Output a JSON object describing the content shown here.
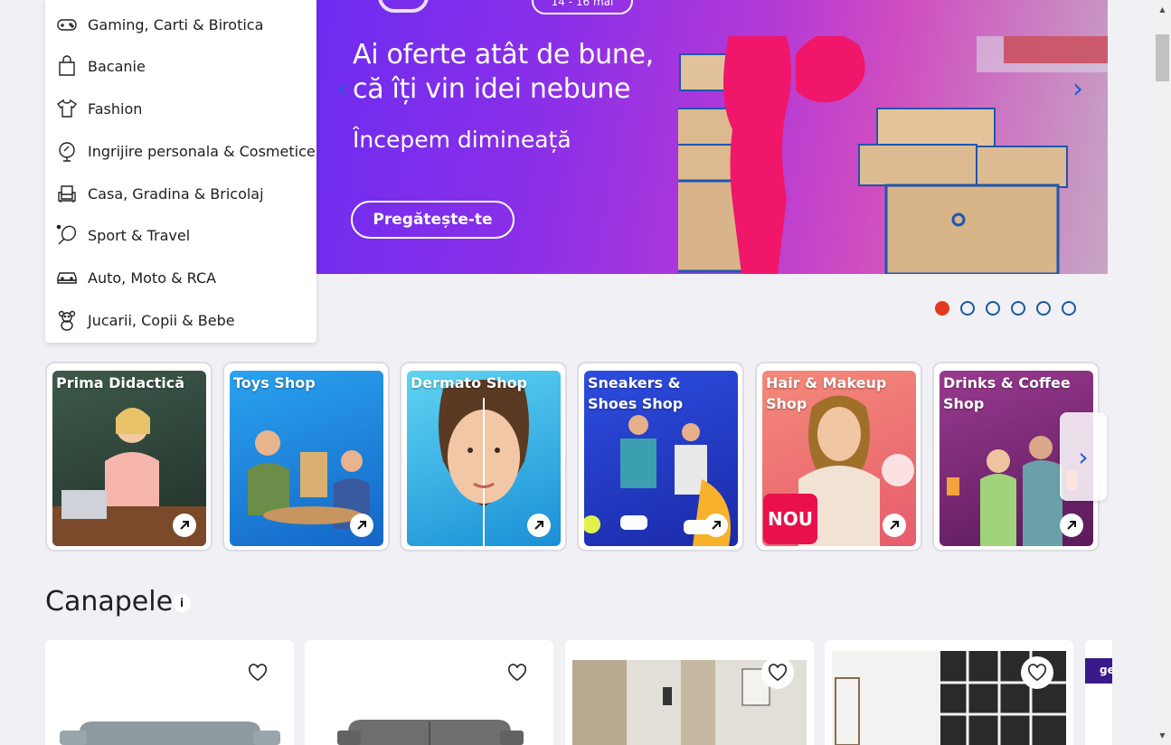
{
  "category_menu": {
    "items": [
      {
        "label": "Gaming, Carti & Birotica",
        "icon": "gamepad-icon"
      },
      {
        "label": "Bacanie",
        "icon": "shopping-bag-icon"
      },
      {
        "label": "Fashion",
        "icon": "tshirt-icon"
      },
      {
        "label": "Ingrijire personala & Cosmetice",
        "icon": "cosmetics-icon"
      },
      {
        "label": "Casa, Gradina & Bricolaj",
        "icon": "armchair-icon"
      },
      {
        "label": "Sport & Travel",
        "icon": "racket-icon"
      },
      {
        "label": "Auto, Moto & RCA",
        "icon": "car-icon"
      },
      {
        "label": "Jucarii, Copii & Bebe",
        "icon": "teddy-bear-icon"
      }
    ]
  },
  "hero": {
    "date_label": "14 - 16 mai",
    "headline_line1": "Ai oferte atât de bune,",
    "headline_line2": "că îți vin idei nebune",
    "subtitle": "Începem dimineață",
    "cta": "Pregătește-te",
    "active_slide": 1,
    "slide_count": 6
  },
  "shops": {
    "items": [
      {
        "title": "Prima Didactică",
        "bg": "#2f4a3c"
      },
      {
        "title": "Toys Shop",
        "bg": "#1e88d8"
      },
      {
        "title": "Dermato Shop",
        "bg": "#2fb6e6"
      },
      {
        "title": "Sneakers & Shoes Shop",
        "bg": "#2b3ed0"
      },
      {
        "title": "Hair & Makeup Shop",
        "bg": "#f1706a",
        "badge": "NOU"
      },
      {
        "title": "Drinks & Coffee Shop",
        "bg": "#8a2a78"
      }
    ]
  },
  "section": {
    "title": "Canapele",
    "info": "i"
  },
  "colors": {
    "accent_red": "#e33a1f",
    "link_blue": "#1f5bd6",
    "page_bg": "#f0f0f5"
  }
}
